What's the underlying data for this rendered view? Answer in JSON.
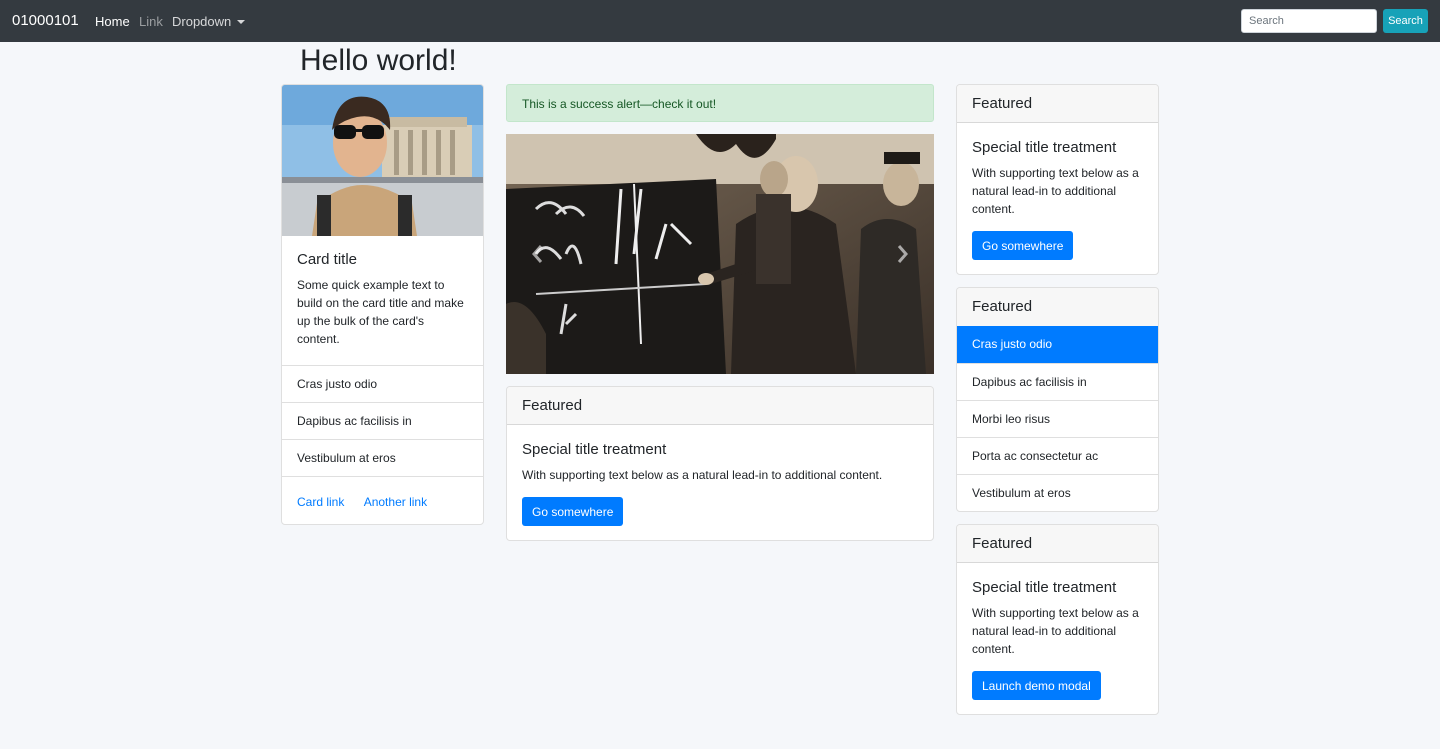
{
  "navbar": {
    "brand": "01000101",
    "links": [
      "Home",
      "Link",
      "Dropdown"
    ],
    "search_placeholder": "Search",
    "search_button": "Search"
  },
  "page": {
    "title": "Hello world!"
  },
  "left_card": {
    "title": "Card title",
    "text": "Some quick example text to build on the card title and make up the bulk of the card's content.",
    "items": [
      "Cras justo odio",
      "Dapibus ac facilisis in",
      "Vestibulum at eros"
    ],
    "links": [
      "Card link",
      "Another link"
    ]
  },
  "alert": {
    "text": "This is a success alert—check it out!"
  },
  "center_card": {
    "header": "Featured",
    "title": "Special title treatment",
    "text": "With supporting text below as a natural lead-in to additional content.",
    "button": "Go somewhere"
  },
  "right_card_1": {
    "header": "Featured",
    "title": "Special title treatment",
    "text": "With supporting text below as a natural lead-in to additional content.",
    "button": "Go somewhere"
  },
  "right_list_card": {
    "header": "Featured",
    "items": [
      "Cras justo odio",
      "Dapibus ac facilisis in",
      "Morbi leo risus",
      "Porta ac consectetur ac",
      "Vestibulum at eros"
    ]
  },
  "right_card_2": {
    "header": "Featured",
    "title": "Special title treatment",
    "text": "With supporting text below as a natural lead-in to additional content.",
    "button": "Launch demo modal"
  },
  "colors": {
    "primary": "#007bff",
    "info": "#17a2b8",
    "navbar": "#343a40",
    "success_bg": "#d4edda",
    "success_text": "#155724"
  },
  "icons": {
    "carousel_prev": "chevron-left-icon",
    "carousel_next": "chevron-right-icon",
    "dropdown": "caret-down-icon"
  }
}
